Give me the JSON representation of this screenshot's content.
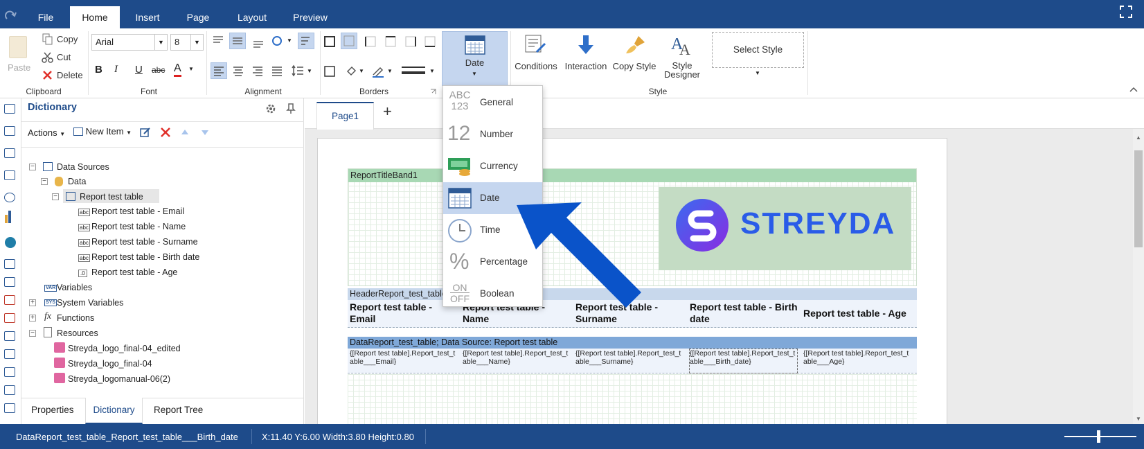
{
  "menu": {
    "tabs": [
      {
        "label": "File"
      },
      {
        "label": "Home"
      },
      {
        "label": "Insert"
      },
      {
        "label": "Page"
      },
      {
        "label": "Layout"
      },
      {
        "label": "Preview"
      }
    ],
    "active_tab": "Home"
  },
  "ribbon": {
    "clipboard": {
      "paste": "Paste",
      "copy": "Copy",
      "cut": "Cut",
      "delete": "Delete",
      "label": "Clipboard"
    },
    "font": {
      "family": "Arial",
      "size": "8",
      "label": "Font",
      "bold": "B",
      "italic": "I",
      "underline": "U",
      "strike": "abc",
      "color": "A"
    },
    "alignment": {
      "label": "Alignment"
    },
    "borders": {
      "label": "Borders"
    },
    "format": {
      "label": "Date"
    },
    "style": {
      "conditions": "Conditions",
      "interaction": "Interaction",
      "copy_style": "Copy Style",
      "style_designer_1": "Style",
      "style_designer_2": "Designer",
      "select_style": "Select Style",
      "label": "Style"
    }
  },
  "format_menu": {
    "items": [
      {
        "label": "General",
        "icon": "general-format-icon",
        "glyph_top": "ABC",
        "glyph_bottom": "123"
      },
      {
        "label": "Number",
        "icon": "number-format-icon",
        "glyph": "12"
      },
      {
        "label": "Currency",
        "icon": "currency-format-icon"
      },
      {
        "label": "Date",
        "icon": "date-format-icon"
      },
      {
        "label": "Time",
        "icon": "time-format-icon"
      },
      {
        "label": "Percentage",
        "icon": "percentage-format-icon",
        "glyph": "%"
      },
      {
        "label": "Boolean",
        "icon": "boolean-format-icon",
        "glyph_top": "ON",
        "glyph_bottom": "OFF"
      }
    ],
    "selected": "Date"
  },
  "dictionary": {
    "title": "Dictionary",
    "actions": "Actions",
    "new_item": "New Item",
    "tree": [
      {
        "label": "Data Sources",
        "type": "folder"
      },
      {
        "label": "Data",
        "type": "db"
      },
      {
        "label": "Report test table",
        "type": "table"
      },
      {
        "label": "Report test table - Email",
        "type": "string"
      },
      {
        "label": "Report test table - Name",
        "type": "string"
      },
      {
        "label": "Report test table - Surname",
        "type": "string"
      },
      {
        "label": "Report test table - Birth date",
        "type": "string"
      },
      {
        "label": "Report test table - Age",
        "type": "number"
      },
      {
        "label": "Variables",
        "type": "var"
      },
      {
        "label": "System Variables",
        "type": "var"
      },
      {
        "label": "Functions",
        "type": "fx"
      },
      {
        "label": "Resources",
        "type": "res"
      },
      {
        "label": "Streyda_logo_final-04_edited",
        "type": "image"
      },
      {
        "label": "Streyda_logo_final-04",
        "type": "image"
      },
      {
        "label": "Streyda_logomanual-06(2)",
        "type": "image"
      }
    ],
    "bottom_tabs": [
      {
        "label": "Properties"
      },
      {
        "label": "Dictionary"
      },
      {
        "label": "Report Tree"
      }
    ]
  },
  "page_tabs": {
    "page1": "Page1",
    "add": "+"
  },
  "report": {
    "title_band": "ReportTitleBand1",
    "logo_text": "STREYDA",
    "header_band": "HeaderReport_test_table",
    "headers": [
      "Report test table - Email",
      "Report test table - Name",
      "Report test table - Surname",
      "Report test table - Birth date",
      "Report test table - Age"
    ],
    "data_band": "DataReport_test_table; Data Source: Report test table",
    "cells": [
      "{[Report test table].Report_test_table___Email}",
      "{[Report test table].Report_test_table___Name}",
      "{[Report test table].Report_test_table___Surname}",
      "{[Report test table].Report_test_table___Birth_date}",
      "{[Report test table].Report_test_table___Age}"
    ]
  },
  "status": {
    "component": "DataReport_test_table_Report_test_table___Birth_date",
    "geometry": "X:11.40 Y:6.00 Width:3.80 Height:0.80"
  },
  "colors": {
    "accent": "#1e4b8a",
    "selection": "#c5d6ef",
    "arrow": "#0a53c9",
    "band_green": "#a8d8b4",
    "band_blue": "#c8d8ec"
  }
}
